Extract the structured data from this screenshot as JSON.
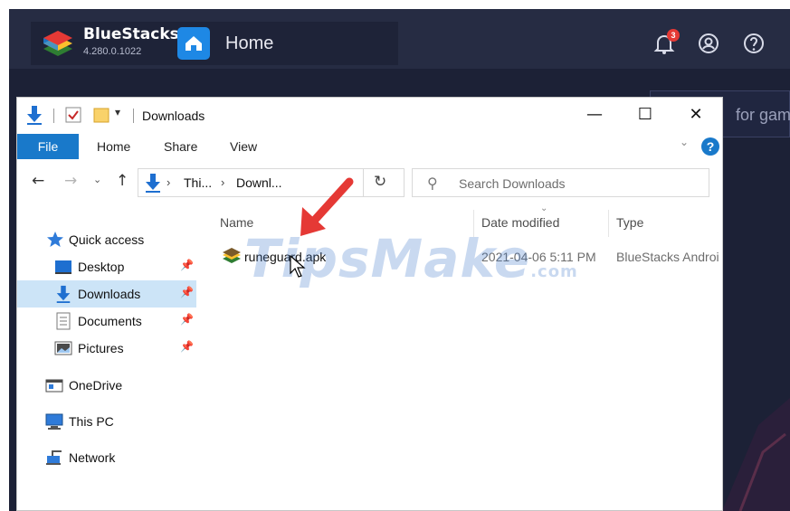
{
  "bluestacks": {
    "app_name": "BlueStacks",
    "version": "4.280.0.1022",
    "home_label": "Home",
    "notification_count": "3",
    "search_placeholder": "for gam"
  },
  "explorer": {
    "window_title": "Downloads",
    "controls": {
      "minimize": "—",
      "maximize": "☐",
      "close": "✕"
    },
    "ribbon": {
      "tabs": [
        "File",
        "Home",
        "Share",
        "View"
      ],
      "expand_glyph": "⌄",
      "help_glyph": "?"
    },
    "navbar": {
      "back": "←",
      "forward": "→",
      "recent": "⌄",
      "up": "↑",
      "path": [
        "Thi...",
        "Downl..."
      ],
      "separator": "›",
      "dropdown": "⌄",
      "refresh": "↻",
      "search_placeholder": "Search Downloads",
      "search_glyph": "⚲"
    },
    "nav_pane": {
      "pin_glyph": "📌",
      "items": [
        {
          "label": "Quick access",
          "icon": "star-icon",
          "pinned": false,
          "selected": false
        },
        {
          "label": "Desktop",
          "icon": "desktop-icon",
          "pinned": true,
          "selected": false
        },
        {
          "label": "Downloads",
          "icon": "download-icon",
          "pinned": true,
          "selected": true
        },
        {
          "label": "Documents",
          "icon": "document-icon",
          "pinned": true,
          "selected": false
        },
        {
          "label": "Pictures",
          "icon": "pictures-icon",
          "pinned": true,
          "selected": false
        },
        {
          "label": "OneDrive",
          "icon": "onedrive-icon",
          "pinned": false,
          "selected": false
        },
        {
          "label": "This PC",
          "icon": "pc-icon",
          "pinned": false,
          "selected": false
        },
        {
          "label": "Network",
          "icon": "network-icon",
          "pinned": false,
          "selected": false
        }
      ]
    },
    "columns": [
      "Name",
      "Date modified",
      "Type"
    ],
    "sort_glyph": "⌄",
    "files": [
      {
        "name": "runeguard.apk",
        "date_modified": "2021-04-06 5:11 PM",
        "type": "BlueStacks Androi"
      }
    ]
  },
  "watermark": {
    "text": "TipsMake",
    "suffix": ".com"
  },
  "colors": {
    "bluestacks_bg": "#1c2136",
    "ribbon_file_tab": "#1979ca",
    "selection": "#cce4f7",
    "arrow_red": "#e53935"
  }
}
